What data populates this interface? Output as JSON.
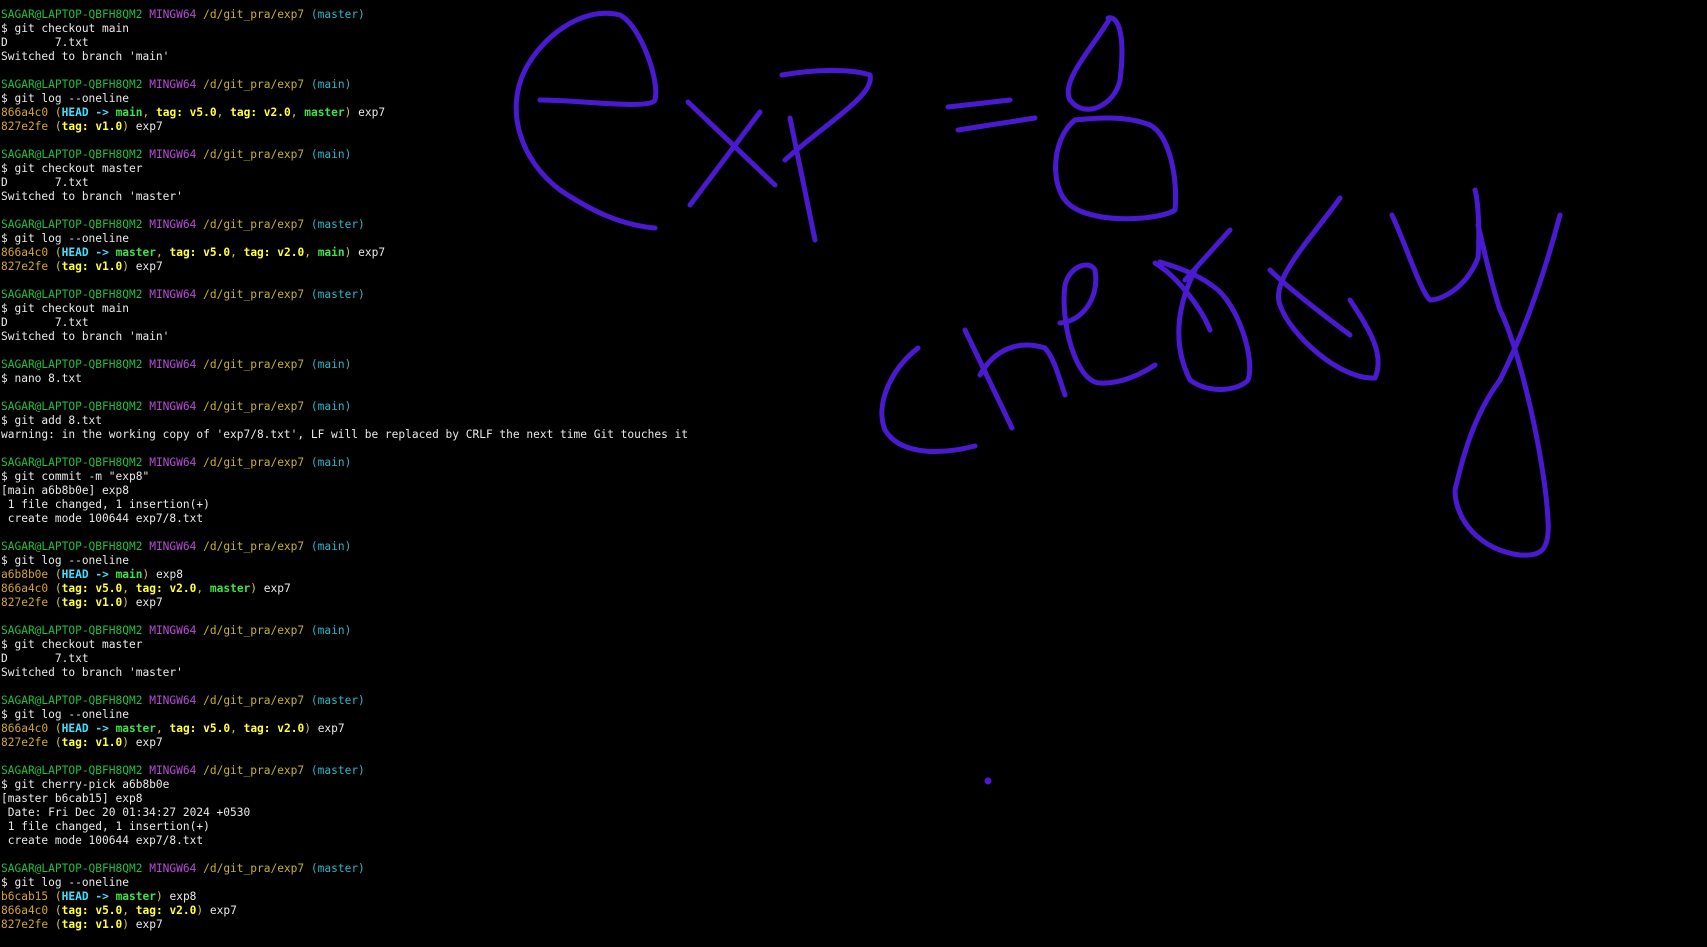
{
  "prompt": {
    "user": "SAGAR@LAPTOP-QBFH8QM2",
    "system": "MINGW64",
    "path": "/d/git_pra/exp7"
  },
  "blocks": [
    {
      "branch": "(master)",
      "command": "$ git checkout main",
      "output": [
        "D       7.txt",
        "Switched to branch 'main'"
      ]
    },
    {
      "branch": "(main)",
      "command": "$ git log --oneline",
      "log": [
        {
          "hash": "866a4c0",
          "refs": [
            {
              "t": "head",
              "v": "HEAD"
            },
            {
              "t": "arrow",
              "v": " -> "
            },
            {
              "t": "branch",
              "v": "main"
            },
            {
              "t": "sep",
              "v": ", "
            },
            {
              "t": "tag",
              "v": "tag: v5.0"
            },
            {
              "t": "sep",
              "v": ", "
            },
            {
              "t": "tag",
              "v": "tag: v2.0"
            },
            {
              "t": "sep",
              "v": ", "
            },
            {
              "t": "branch",
              "v": "master"
            }
          ],
          "msg": " exp7"
        },
        {
          "hash": "827e2fe",
          "refs": [
            {
              "t": "tag",
              "v": "tag: v1.0"
            }
          ],
          "msg": " exp7"
        }
      ]
    },
    {
      "branch": "(main)",
      "command": "$ git checkout master",
      "output": [
        "D       7.txt",
        "Switched to branch 'master'"
      ]
    },
    {
      "branch": "(master)",
      "command": "$ git log --oneline",
      "log": [
        {
          "hash": "866a4c0",
          "refs": [
            {
              "t": "head",
              "v": "HEAD"
            },
            {
              "t": "arrow",
              "v": " -> "
            },
            {
              "t": "branch",
              "v": "master"
            },
            {
              "t": "sep",
              "v": ", "
            },
            {
              "t": "tag",
              "v": "tag: v5.0"
            },
            {
              "t": "sep",
              "v": ", "
            },
            {
              "t": "tag",
              "v": "tag: v2.0"
            },
            {
              "t": "sep",
              "v": ", "
            },
            {
              "t": "branch",
              "v": "main"
            }
          ],
          "msg": " exp7"
        },
        {
          "hash": "827e2fe",
          "refs": [
            {
              "t": "tag",
              "v": "tag: v1.0"
            }
          ],
          "msg": " exp7"
        }
      ]
    },
    {
      "branch": "(master)",
      "command": "$ git checkout main",
      "output": [
        "D       7.txt",
        "Switched to branch 'main'"
      ]
    },
    {
      "branch": "(main)",
      "command": "$ nano 8.txt",
      "output": []
    },
    {
      "branch": "(main)",
      "command": "$ git add 8.txt",
      "output": [
        "warning: in the working copy of 'exp7/8.txt', LF will be replaced by CRLF the next time Git touches it"
      ]
    },
    {
      "branch": "(main)",
      "command": "$ git commit -m \"exp8\"",
      "output": [
        "[main a6b8b0e] exp8",
        " 1 file changed, 1 insertion(+)",
        " create mode 100644 exp7/8.txt"
      ]
    },
    {
      "branch": "(main)",
      "command": "$ git log --oneline",
      "log": [
        {
          "hash": "a6b8b0e",
          "refs": [
            {
              "t": "head",
              "v": "HEAD"
            },
            {
              "t": "arrow",
              "v": " -> "
            },
            {
              "t": "branch",
              "v": "main"
            }
          ],
          "msg": " exp8"
        },
        {
          "hash": "866a4c0",
          "refs": [
            {
              "t": "tag",
              "v": "tag: v5.0"
            },
            {
              "t": "sep",
              "v": ", "
            },
            {
              "t": "tag",
              "v": "tag: v2.0"
            },
            {
              "t": "sep",
              "v": ", "
            },
            {
              "t": "branch",
              "v": "master"
            }
          ],
          "msg": " exp7"
        },
        {
          "hash": "827e2fe",
          "refs": [
            {
              "t": "tag",
              "v": "tag: v1.0"
            }
          ],
          "msg": " exp7"
        }
      ]
    },
    {
      "branch": "(main)",
      "command": "$ git checkout master",
      "output": [
        "D       7.txt",
        "Switched to branch 'master'"
      ]
    },
    {
      "branch": "(master)",
      "command": "$ git log --oneline",
      "log": [
        {
          "hash": "866a4c0",
          "refs": [
            {
              "t": "head",
              "v": "HEAD"
            },
            {
              "t": "arrow",
              "v": " -> "
            },
            {
              "t": "branch",
              "v": "master"
            },
            {
              "t": "sep",
              "v": ", "
            },
            {
              "t": "tag",
              "v": "tag: v5.0"
            },
            {
              "t": "sep",
              "v": ", "
            },
            {
              "t": "tag",
              "v": "tag: v2.0"
            }
          ],
          "msg": " exp7"
        },
        {
          "hash": "827e2fe",
          "refs": [
            {
              "t": "tag",
              "v": "tag: v1.0"
            }
          ],
          "msg": " exp7"
        }
      ]
    },
    {
      "branch": "(master)",
      "command": "$ git cherry-pick a6b8b0e",
      "output": [
        "[master b6cab15] exp8",
        " Date: Fri Dec 20 01:34:27 2024 +0530",
        " 1 file changed, 1 insertion(+)",
        " create mode 100644 exp7/8.txt"
      ]
    },
    {
      "branch": "(master)",
      "command": "$ git log --oneline",
      "log": [
        {
          "hash": "b6cab15",
          "refs": [
            {
              "t": "head",
              "v": "HEAD"
            },
            {
              "t": "arrow",
              "v": " -> "
            },
            {
              "t": "branch",
              "v": "master"
            }
          ],
          "msg": " exp8"
        },
        {
          "hash": "866a4c0",
          "refs": [
            {
              "t": "tag",
              "v": "tag: v5.0"
            },
            {
              "t": "sep",
              "v": ", "
            },
            {
              "t": "tag",
              "v": "tag: v2.0"
            }
          ],
          "msg": " exp7"
        },
        {
          "hash": "827e2fe",
          "refs": [
            {
              "t": "tag",
              "v": "tag: v1.0"
            }
          ],
          "msg": " exp7"
        }
      ]
    }
  ],
  "annotation": {
    "text": "exp = 8 cherry",
    "color": "#4a1ad0"
  },
  "colors": {
    "background": "#000000",
    "user": "#1fbf3f",
    "system": "#b84ad8",
    "path": "#c7b12a",
    "branch_prompt": "#2bb5c9",
    "hash": "#d4a52a",
    "head": "#3fe0ff",
    "ref_branch": "#3fe04a",
    "ref_tag": "#ffff3a"
  }
}
